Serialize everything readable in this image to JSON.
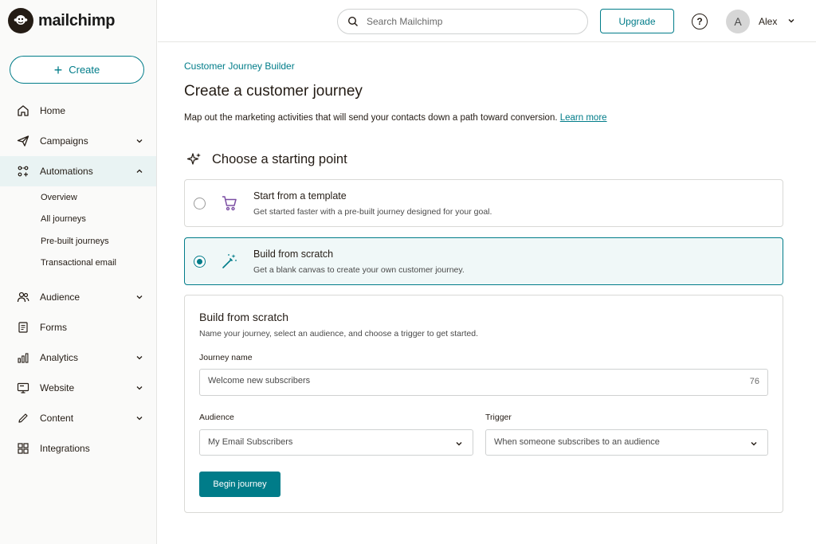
{
  "brand": {
    "name": "mailchimp",
    "accent": "#007c89"
  },
  "sidebar": {
    "create_label": "Create",
    "items": [
      {
        "label": "Home",
        "icon": "home-icon"
      },
      {
        "label": "Campaigns",
        "icon": "paper-plane-icon"
      },
      {
        "label": "Automations",
        "icon": "automation-icon"
      },
      {
        "label": "Audience",
        "icon": "people-icon"
      },
      {
        "label": "Forms",
        "icon": "form-icon"
      },
      {
        "label": "Analytics",
        "icon": "bar-chart-icon"
      },
      {
        "label": "Website",
        "icon": "monitor-icon"
      },
      {
        "label": "Content",
        "icon": "pen-icon"
      },
      {
        "label": "Integrations",
        "icon": "grid-icon"
      }
    ],
    "automation_sub": [
      "Overview",
      "All journeys",
      "Pre-built journeys",
      "Transactional email"
    ]
  },
  "topbar": {
    "search_placeholder": "Search Mailchimp",
    "upgrade_label": "Upgrade",
    "help_label": "?",
    "avatar_initial": "A",
    "user_name": "Alex"
  },
  "main": {
    "breadcrumb": "Customer Journey Builder",
    "title": "Create a customer journey",
    "description": "Map out the marketing activities that will send your contacts down a path toward conversion.",
    "learn_more": "Learn more",
    "section_title": "Choose a starting point",
    "options": [
      {
        "title": "Start from a template",
        "desc": "Get started faster with a pre-built journey designed for your goal.",
        "selected": false
      },
      {
        "title": "Build from scratch",
        "desc": "Get a blank canvas to create your own customer journey.",
        "selected": true
      }
    ],
    "form": {
      "title": "Build from scratch",
      "desc": "Name your journey, select an audience, and choose a trigger to get started.",
      "journey_name_label": "Journey name",
      "journey_name_value": "Welcome new subscribers",
      "journey_name_counter": "76",
      "audience_label": "Audience",
      "audience_value": "My Email Subscribers",
      "trigger_label": "Trigger",
      "trigger_value": "When someone subscribes to an audience",
      "submit_label": "Begin journey"
    }
  }
}
